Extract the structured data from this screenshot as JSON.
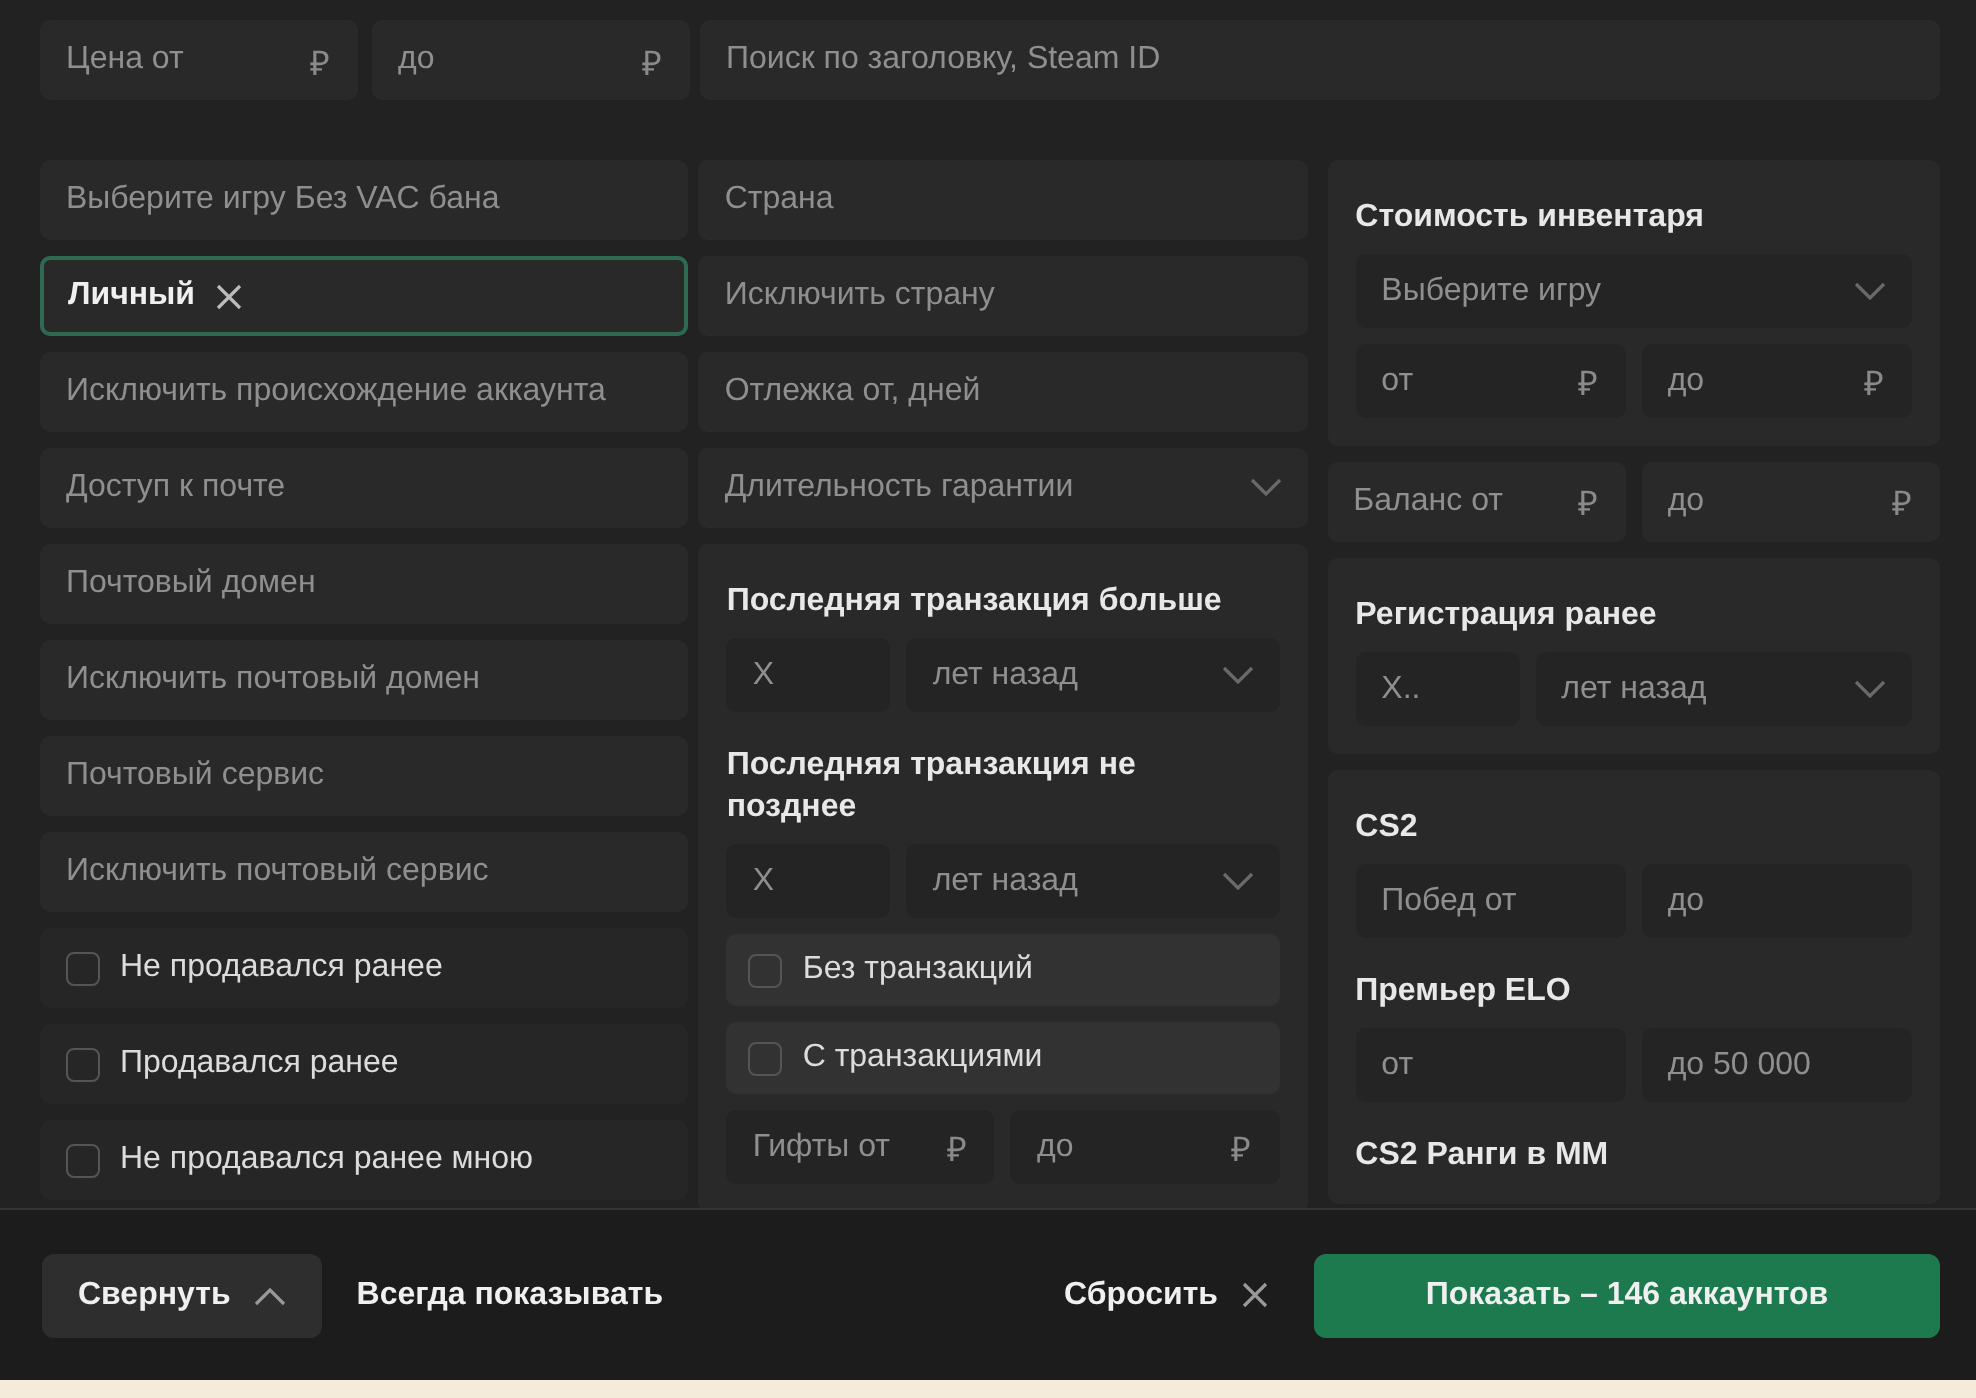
{
  "top": {
    "price_from": {
      "placeholder": "Цена от",
      "suffix": "₽"
    },
    "price_to": {
      "placeholder": "до",
      "suffix": "₽"
    },
    "search": {
      "placeholder": "Поиск по заголовку, Steam ID"
    }
  },
  "columns": [
    {
      "items": [
        {
          "kind": "field",
          "placeholder": "Выберите игру Без VAC бана"
        },
        {
          "kind": "tags",
          "focused": true,
          "tags": [
            {
              "label": "Личный"
            }
          ]
        },
        {
          "kind": "field",
          "placeholder": "Исключить происхождение аккаунта"
        },
        {
          "kind": "field",
          "placeholder": "Доступ к почте"
        },
        {
          "kind": "field",
          "placeholder": "Почтовый домен"
        },
        {
          "kind": "field",
          "placeholder": "Исключить почтовый домен"
        },
        {
          "kind": "field",
          "placeholder": "Почтовый сервис"
        },
        {
          "kind": "field",
          "placeholder": "Исключить почтовый сервис"
        },
        {
          "kind": "checkbox",
          "label": "Не продавался ранее",
          "checked": false
        },
        {
          "kind": "checkbox",
          "label": "Продавался ранее",
          "checked": false
        },
        {
          "kind": "checkbox",
          "label": "Не продавался ранее мною",
          "checked": false
        }
      ]
    },
    {
      "items": [
        {
          "kind": "field",
          "placeholder": "Страна"
        },
        {
          "kind": "field",
          "placeholder": "Исключить страну"
        },
        {
          "kind": "field",
          "placeholder": "Отлежка от, дней"
        },
        {
          "kind": "select",
          "placeholder": "Длительность гарантии"
        },
        {
          "kind": "panel",
          "blocks": [
            {
              "kind": "heading",
              "text": "Последняя транзакция больше"
            },
            {
              "kind": "pair",
              "fields": [
                {
                  "kind": "input",
                  "placeholder": "X"
                },
                {
                  "kind": "select",
                  "placeholder": "лет назад"
                }
              ]
            },
            {
              "kind": "heading",
              "text": "Последняя транзакция не позднее"
            },
            {
              "kind": "pair",
              "fields": [
                {
                  "kind": "input",
                  "placeholder": "X"
                },
                {
                  "kind": "select",
                  "placeholder": "лет назад"
                }
              ]
            },
            {
              "kind": "checkbox",
              "label": "Без транзакций",
              "checked": false
            },
            {
              "kind": "checkbox",
              "label": "С транзакциями",
              "checked": false
            },
            {
              "kind": "pair",
              "fields": [
                {
                  "kind": "input",
                  "placeholder": "Гифты от",
                  "suffix": "₽"
                },
                {
                  "kind": "input",
                  "placeholder": "до",
                  "suffix": "₽"
                }
              ]
            }
          ]
        }
      ]
    },
    {
      "items": [
        {
          "kind": "panel",
          "blocks": [
            {
              "kind": "heading",
              "text": "Стоимость инвентаря"
            },
            {
              "kind": "select",
              "placeholder": "Выберите игру"
            },
            {
              "kind": "pair",
              "fields": [
                {
                  "kind": "input",
                  "placeholder": "от",
                  "suffix": "₽"
                },
                {
                  "kind": "input",
                  "placeholder": "до",
                  "suffix": "₽"
                }
              ]
            }
          ]
        },
        {
          "kind": "pair",
          "fields": [
            {
              "kind": "input",
              "placeholder": "Баланс от",
              "suffix": "₽"
            },
            {
              "kind": "input",
              "placeholder": "до",
              "suffix": "₽"
            }
          ]
        },
        {
          "kind": "panel",
          "blocks": [
            {
              "kind": "heading",
              "text": "Регистрация ранее"
            },
            {
              "kind": "pair",
              "fields": [
                {
                  "kind": "input",
                  "placeholder": "X.."
                },
                {
                  "kind": "select",
                  "placeholder": "лет назад"
                }
              ]
            }
          ]
        },
        {
          "kind": "panel",
          "blocks": [
            {
              "kind": "heading",
              "text": "CS2"
            },
            {
              "kind": "pair",
              "fields": [
                {
                  "kind": "input",
                  "placeholder": "Побед от"
                },
                {
                  "kind": "input",
                  "placeholder": "до"
                }
              ]
            },
            {
              "kind": "heading",
              "text": "Премьер ELO"
            },
            {
              "kind": "pair",
              "fields": [
                {
                  "kind": "input",
                  "placeholder": "от"
                },
                {
                  "kind": "input",
                  "placeholder": "до 50 000"
                }
              ]
            },
            {
              "kind": "heading",
              "text": "CS2 Ранги в ММ"
            }
          ]
        }
      ]
    }
  ],
  "footer": {
    "collapse_button": "Свернуть",
    "always_show_link": "Всегда показывать",
    "reset_button": "Сбросить",
    "show_button": "Показать – 146 аккаунтов"
  }
}
